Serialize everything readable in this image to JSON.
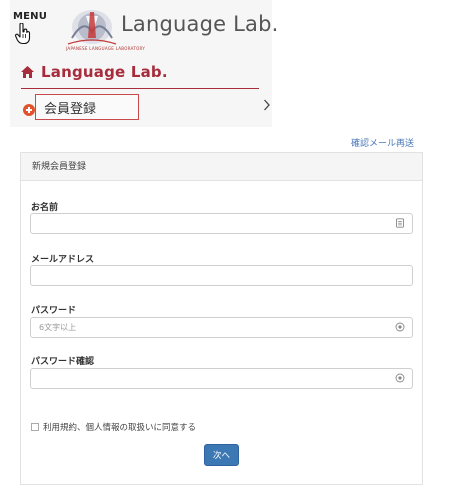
{
  "header": {
    "menu_label": "MENU",
    "logo_text": "Language Lab.",
    "logo_sub": "JAPANESE LANGUAGE LABORATORY"
  },
  "nav": {
    "home_label": "Language Lab.",
    "register_label": "会員登録"
  },
  "links": {
    "resend": "確認メール再送"
  },
  "form": {
    "panel_title": "新規会員登録",
    "name": {
      "label": "お名前",
      "value": "",
      "placeholder": ""
    },
    "email": {
      "label": "メールアドレス",
      "value": "",
      "placeholder": ""
    },
    "password": {
      "label": "パスワード",
      "value": "",
      "placeholder": "6文字以上"
    },
    "password_confirm": {
      "label": "パスワード確認",
      "value": "",
      "placeholder": ""
    },
    "agree_label": "利用規約、個人情報の取扱いに同意する",
    "agree_checked": false,
    "next_label": "次へ"
  },
  "colors": {
    "brand": "#a72c3c",
    "accent_orange": "#e0532d",
    "button": "#3c78b4",
    "link": "#4a78b8"
  },
  "icons": {
    "menu": "pointer-hand-icon",
    "home": "home-icon",
    "register": "plus-circle-icon",
    "chevron": "chevron-right-icon",
    "name_field": "contact-card-icon",
    "password_field": "eye-icon"
  }
}
